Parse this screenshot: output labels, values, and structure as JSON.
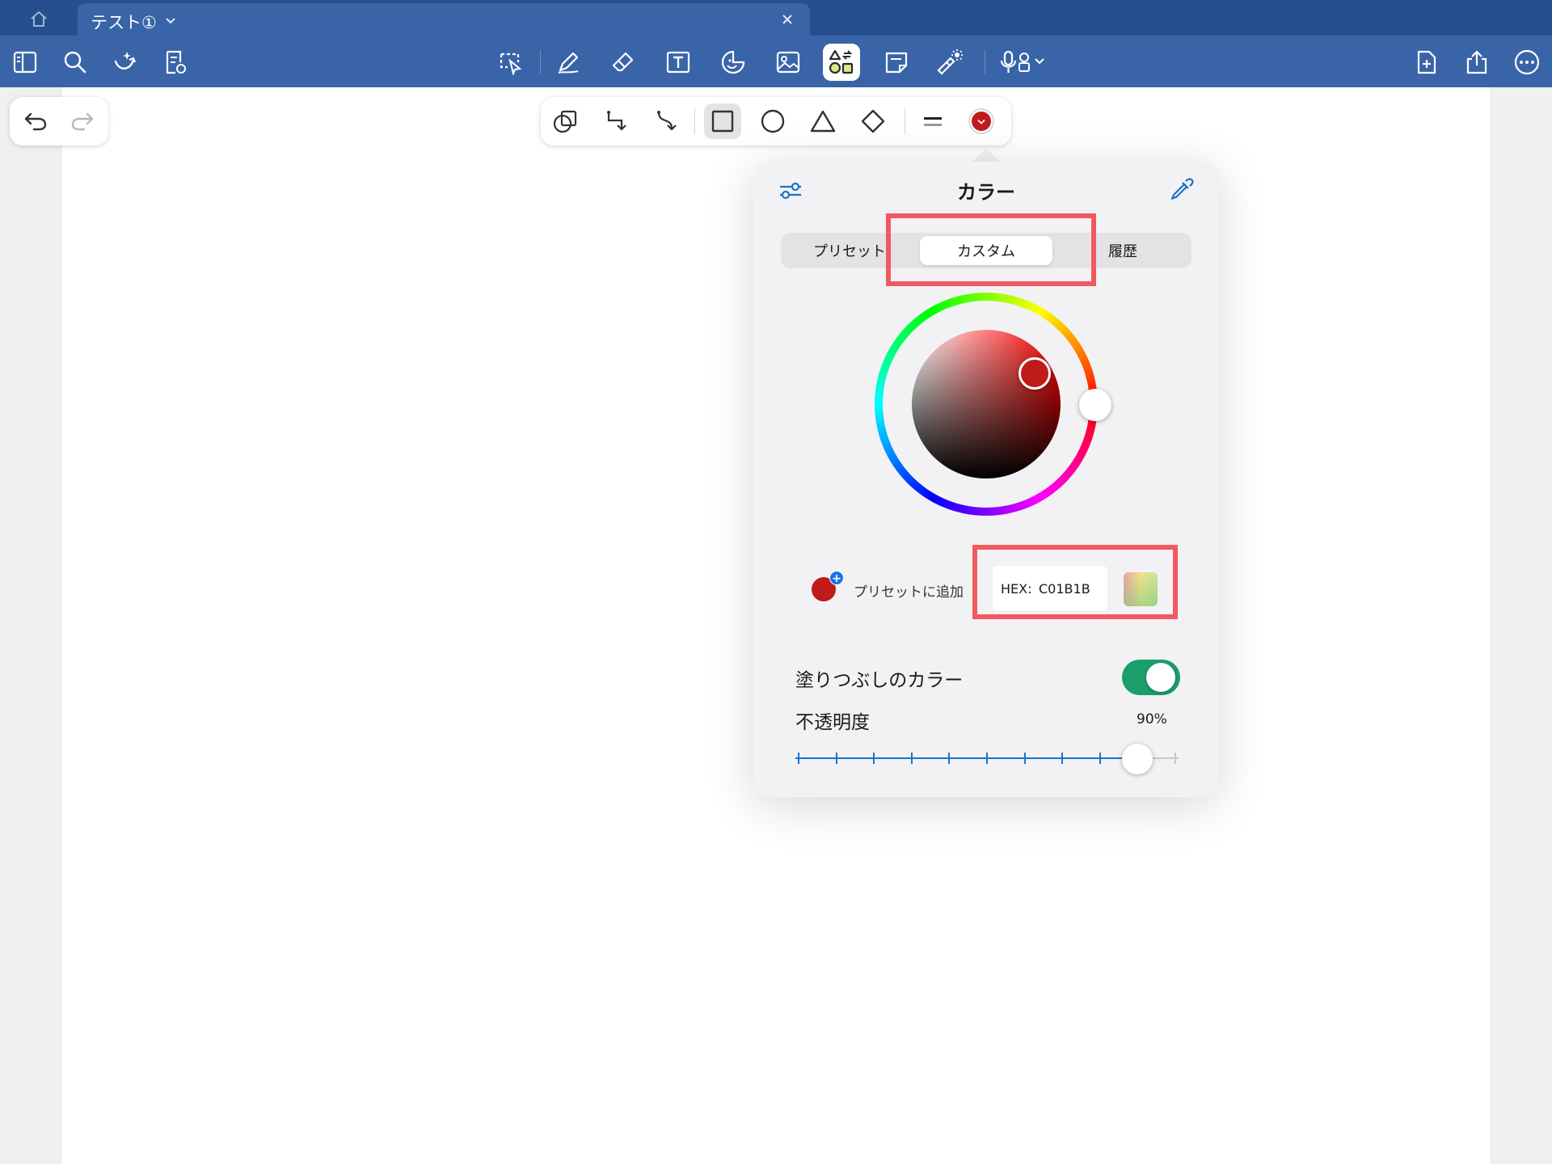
{
  "tab": {
    "title": "テスト①"
  },
  "colors": {
    "accent": "#1a73c8",
    "selected_color": "#c01b1b",
    "toggle_on": "#1a9e6a",
    "highlight": "#f05a5f"
  },
  "popover": {
    "title": "カラー",
    "segments": {
      "preset": "プリセット",
      "custom": "カスタム",
      "history": "履歴"
    },
    "selected_segment": "カスタム",
    "add_preset_label": "プリセットに追加",
    "hex_label": "HEX:",
    "hex_value": "C01B1B",
    "fill_label": "塗りつぶしのカラー",
    "fill_enabled": true,
    "opacity_label": "不透明度",
    "opacity_text": "90%",
    "opacity_value": 0.9
  }
}
